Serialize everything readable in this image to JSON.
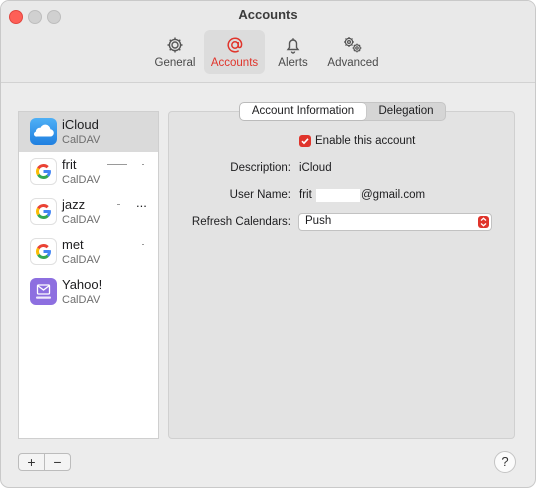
{
  "window": {
    "title": "Accounts"
  },
  "toolbar": {
    "tabs": [
      {
        "label": "General",
        "icon": "gear-icon"
      },
      {
        "label": "Accounts",
        "icon": "at-sign-icon",
        "active": true
      },
      {
        "label": "Alerts",
        "icon": "bell-icon"
      },
      {
        "label": "Advanced",
        "icon": "gears-icon"
      }
    ]
  },
  "sidebar": {
    "accounts": [
      {
        "name": "iCloud",
        "type": "CalDAV",
        "icon": "icloud-icon"
      },
      {
        "name": "frit",
        "type": "CalDAV",
        "icon": "google-icon"
      },
      {
        "name": "jazz",
        "type": "CalDAV",
        "icon": "google-icon",
        "suffix": "..."
      },
      {
        "name": "met",
        "type": "CalDAV",
        "icon": "google-icon"
      },
      {
        "name": "Yahoo!",
        "type": "CalDAV",
        "icon": "yahoo-icon"
      }
    ]
  },
  "segmented": {
    "tab1": "Account Information",
    "tab2": "Delegation"
  },
  "form": {
    "enable_label": "Enable this account",
    "enabled": true,
    "description_label": "Description:",
    "description_value": "iCloud",
    "username_label": "User Name:",
    "username_prefix": "frit",
    "username_suffix": "@gmail.com",
    "refresh_label": "Refresh Calendars:",
    "refresh_value": "Push"
  },
  "footer": {
    "add_label": "+",
    "remove_label": "−",
    "help_label": "?"
  },
  "colors": {
    "accent": "#e0342b",
    "selection": "#dadada",
    "google_blue": "#4285F4",
    "yahoo_purple": "#7b5fd6"
  }
}
